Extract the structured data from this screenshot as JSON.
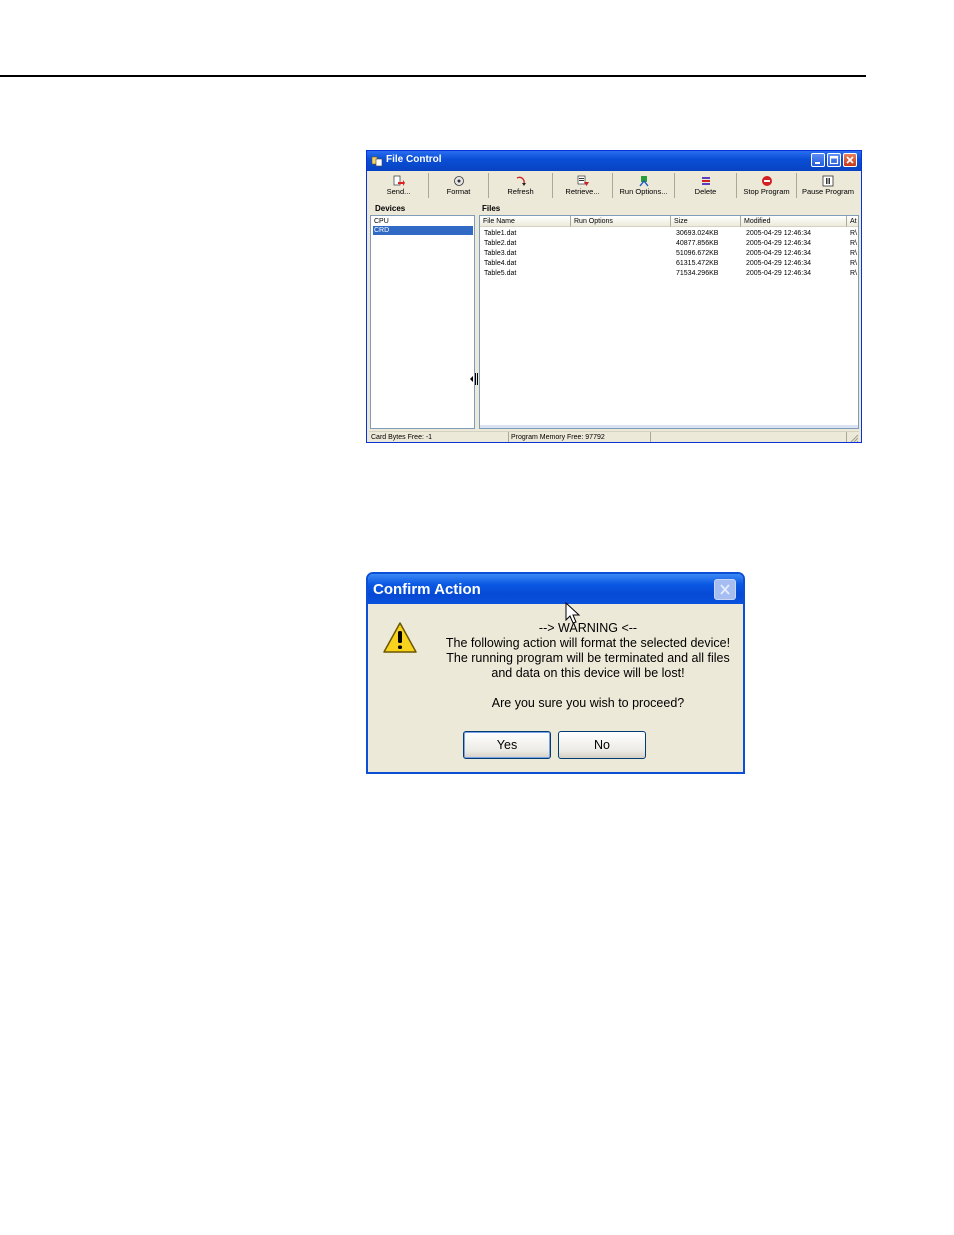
{
  "file_control": {
    "title": "File Control",
    "toolbar": [
      {
        "label": "Send...",
        "icon": "send-icon"
      },
      {
        "label": "Format",
        "icon": "format-icon"
      },
      {
        "label": "Refresh",
        "icon": "refresh-icon"
      },
      {
        "label": "Retrieve...",
        "icon": "retrieve-icon"
      },
      {
        "label": "Run Options...",
        "icon": "run-options-icon"
      },
      {
        "label": "Delete",
        "icon": "delete-icon"
      },
      {
        "label": "Stop Program",
        "icon": "stop-icon"
      },
      {
        "label": "Pause Program",
        "icon": "pause-icon"
      }
    ],
    "devices_label": "Devices",
    "devices": [
      "CPU",
      "CRD"
    ],
    "selected_device": "CRD",
    "files_label": "Files",
    "columns": [
      "File Name",
      "Run Options",
      "Size",
      "Modified",
      "At"
    ],
    "files": [
      {
        "name": "Table1.dat",
        "run_options": "",
        "size": "30693.024KB",
        "modified": "2005-04-29 12:46:34",
        "attr": "R\\"
      },
      {
        "name": "Table2.dat",
        "run_options": "",
        "size": "40877.856KB",
        "modified": "2005-04-29 12:46:34",
        "attr": "R\\"
      },
      {
        "name": "Table3.dat",
        "run_options": "",
        "size": "51096.672KB",
        "modified": "2005-04-29 12:46:34",
        "attr": "R\\"
      },
      {
        "name": "Table4.dat",
        "run_options": "",
        "size": "61315.472KB",
        "modified": "2005-04-29 12:46:34",
        "attr": "R\\"
      },
      {
        "name": "Table5.dat",
        "run_options": "",
        "size": "71534.296KB",
        "modified": "2005-04-29 12:46:34",
        "attr": "R\\"
      }
    ],
    "status": {
      "card_bytes": "Card Bytes Free: -1",
      "program_memory": "Program Memory Free: 97792"
    }
  },
  "confirm": {
    "title": "Confirm Action",
    "lines": [
      "--> WARNING <--",
      "The following action will format the selected device!",
      "The running program will be terminated and all files",
      "and data on this device will be lost!",
      "",
      "Are you sure you wish to proceed?"
    ],
    "yes_label": "Yes",
    "no_label": "No"
  },
  "colors": {
    "xp_title_blue": "#0a4fd6",
    "window_face": "#ece9d8",
    "selection": "#316ac5"
  }
}
